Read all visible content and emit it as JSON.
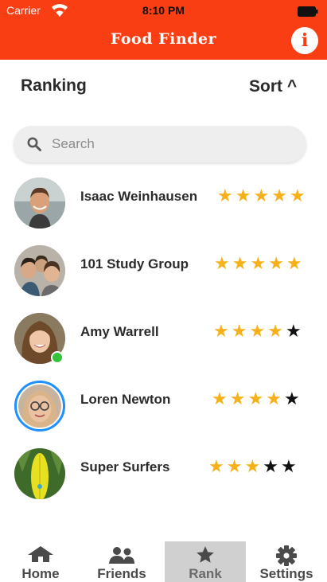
{
  "status_bar": {
    "carrier": "Carrier",
    "time": "8:10 PM"
  },
  "header": {
    "title": "Food Finder",
    "info_icon": "info-icon"
  },
  "ranking": {
    "title": "Ranking",
    "sort_label": "Sort ^"
  },
  "search": {
    "placeholder": "Search"
  },
  "colors": {
    "header_bg": "#fa3e14",
    "star_gold": "#f6b11a",
    "star_black": "#111111",
    "online": "#36c23b",
    "ring": "#1e90ff"
  },
  "rankings": [
    {
      "name": "Isaac Weinhausen",
      "rating": 5,
      "avatar": "man-face"
    },
    {
      "name": "101 Study Group",
      "rating": 5,
      "avatar": "group-photo"
    },
    {
      "name": "Amy Warrell",
      "rating": 4,
      "avatar": "woman-face",
      "online": true
    },
    {
      "name": "Loren Newton",
      "rating": 4,
      "avatar": "woman-face-glasses",
      "highlighted": true
    },
    {
      "name": "Super Surfers",
      "rating": 3,
      "avatar": "surfboard"
    }
  ],
  "tabs": [
    {
      "label": "Home",
      "icon": "home-icon",
      "active": false
    },
    {
      "label": "Friends",
      "icon": "friends-icon",
      "active": false
    },
    {
      "label": "Rank",
      "icon": "star-icon",
      "active": true
    },
    {
      "label": "Settings",
      "icon": "gear-icon",
      "active": false
    }
  ]
}
